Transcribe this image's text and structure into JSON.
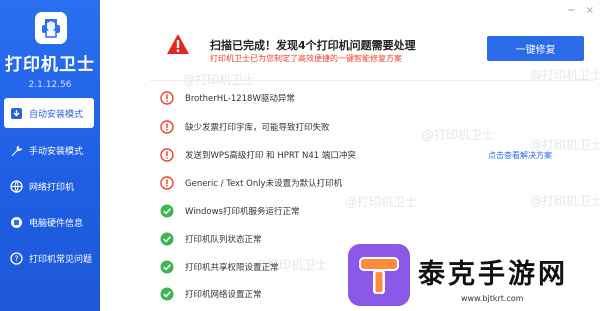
{
  "app": {
    "name": "打印机卫士",
    "version": "2.1.12.56"
  },
  "sidebar": {
    "items": [
      {
        "label": "自动安装模式",
        "icon": "auto-install-icon",
        "active": true
      },
      {
        "label": "手动安装模式",
        "icon": "wrench-icon",
        "active": false
      },
      {
        "label": "网络打印机",
        "icon": "network-icon",
        "active": false
      },
      {
        "label": "电脑硬件信息",
        "icon": "hardware-icon",
        "active": false
      },
      {
        "label": "打印机常见问题",
        "icon": "faq-icon",
        "active": false
      }
    ]
  },
  "window_controls": [
    "−",
    "×"
  ],
  "header": {
    "title": "扫描已完成！发现4个打印机问题需要处理",
    "subtitle": "打印机卫士已为您制定了高效便捷的一键智能修复方案",
    "repair_button": "一键修复"
  },
  "results": [
    {
      "status": "error",
      "text": "BrotherHL-1218W驱动异常"
    },
    {
      "status": "error",
      "text": "缺少发票打印字库，可能导致打印失败"
    },
    {
      "status": "error",
      "text": "发送到WPS高级打印 和 HPRT N41 端口冲突",
      "link": "点击查看解决方案"
    },
    {
      "status": "error",
      "text": "Generic / Text Only未设置为默认打印机"
    },
    {
      "status": "ok",
      "text": "Windows打印机服务运行正常"
    },
    {
      "status": "ok",
      "text": "打印机队列状态正常"
    },
    {
      "status": "ok",
      "text": "打印机共享权限设置正常"
    },
    {
      "status": "ok",
      "text": "打印机网络设置正常"
    }
  ],
  "watermark": "@打印机卫士",
  "promo": {
    "title": "泰克手游网",
    "url": "www.bjtkrt.com"
  },
  "colors": {
    "sidebar_blue": "#2a6ff0",
    "button_blue": "#2c6be8",
    "error_red": "#e8442f",
    "ok_green": "#3fb450",
    "promo_purple": "#8b58e8"
  }
}
